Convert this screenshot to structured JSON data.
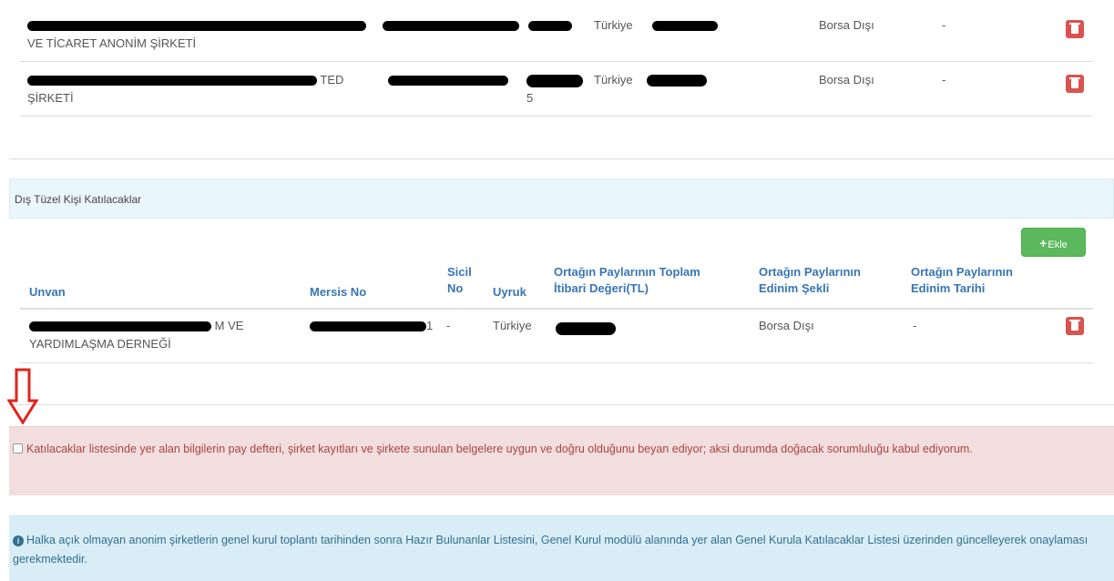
{
  "top_table": {
    "rows": [
      {
        "unvan_line2": "VE TİCARET ANONİM ŞİRKETİ",
        "uyruk": "Türkiye",
        "edinim_sekli": "Borsa Dışı",
        "edinim_tarihi": "-"
      },
      {
        "unvan_line1_end": "TED",
        "unvan_line2": "ŞİRKETİ",
        "sicil_line2": "5",
        "uyruk": "Türkiye",
        "edinim_sekli": "Borsa Dışı",
        "edinim_tarihi": "-"
      }
    ]
  },
  "dis_tuzel": {
    "title": "Dış Tüzel Kişi Katılacaklar",
    "add_button": {
      "icon": "plus-icon",
      "label": "Ekle"
    },
    "columns": {
      "unvan": "Unvan",
      "mersis": "Mersis No",
      "sicil_line1": "Sicil",
      "sicil_line2": "No",
      "uyruk": "Uyruk",
      "toplam_line1": "Ortağın Paylarının Toplam",
      "toplam_line2": "İtibari Değeri(TL)",
      "sekli_line1": "Ortağın Paylarının",
      "sekli_line2": "Edinim Şekli",
      "tarihi_line1": "Ortağın Paylarının",
      "tarihi_line2": "Edinim Tarihi"
    },
    "rows": [
      {
        "unvan_line1_end": "M VE",
        "unvan_line2": "YARDIMLAŞMA DERNEĞİ",
        "mersis_end": "1",
        "sicil": "-",
        "uyruk": "Türkiye",
        "edinim_sekli": "Borsa Dışı",
        "edinim_tarihi": "-"
      }
    ]
  },
  "declaration": {
    "text": "Katılacaklar listesinde yer alan bilgilerin pay defteri, şirket kayıtları ve şirkete sunulan belgelere uygun ve doğru olduğunu beyan ediyor; aksi durumda doğacak sorumluluğu kabul ediyorum."
  },
  "info": {
    "icon": "info-circle-icon",
    "text": "Halka açık olmayan anonim şirketlerin genel kurul toplantı tarihinden sonra Hazır Bulunanlar Listesini, Genel Kurul modülü alanında yer alan Genel Kurula Katılacaklar Listesi üzerinden güncelleyerek onaylaması gerekmektedir."
  },
  "colors": {
    "link_blue": "#3775b7",
    "danger": "#d9534f",
    "success": "#5cb85c",
    "annotation_red": "#e0241b"
  }
}
